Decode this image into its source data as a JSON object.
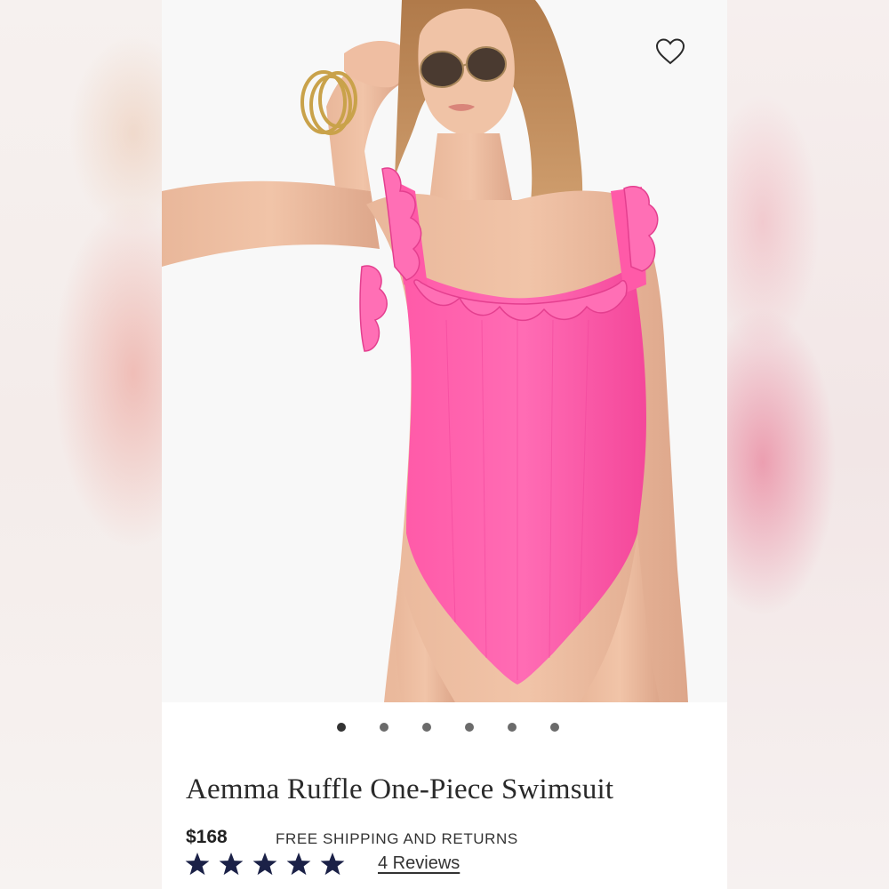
{
  "product": {
    "title": "Aemma Ruffle One-Piece Swimsuit",
    "price": "$168",
    "shipping_note": "FREE SHIPPING AND RETURNS",
    "rating": 5,
    "rating_max": 5,
    "reviews_link": "4 Reviews",
    "image_icon": "product-photo-swimsuit"
  },
  "carousel": {
    "count": 6,
    "active_index": 0
  },
  "icons": {
    "wishlist": "heart-outline-icon",
    "rating": "star-icon"
  },
  "colors": {
    "swimsuit_pink": "#ff4fa3",
    "star_navy": "#1b2147",
    "text_dark": "#2a2a2a"
  }
}
